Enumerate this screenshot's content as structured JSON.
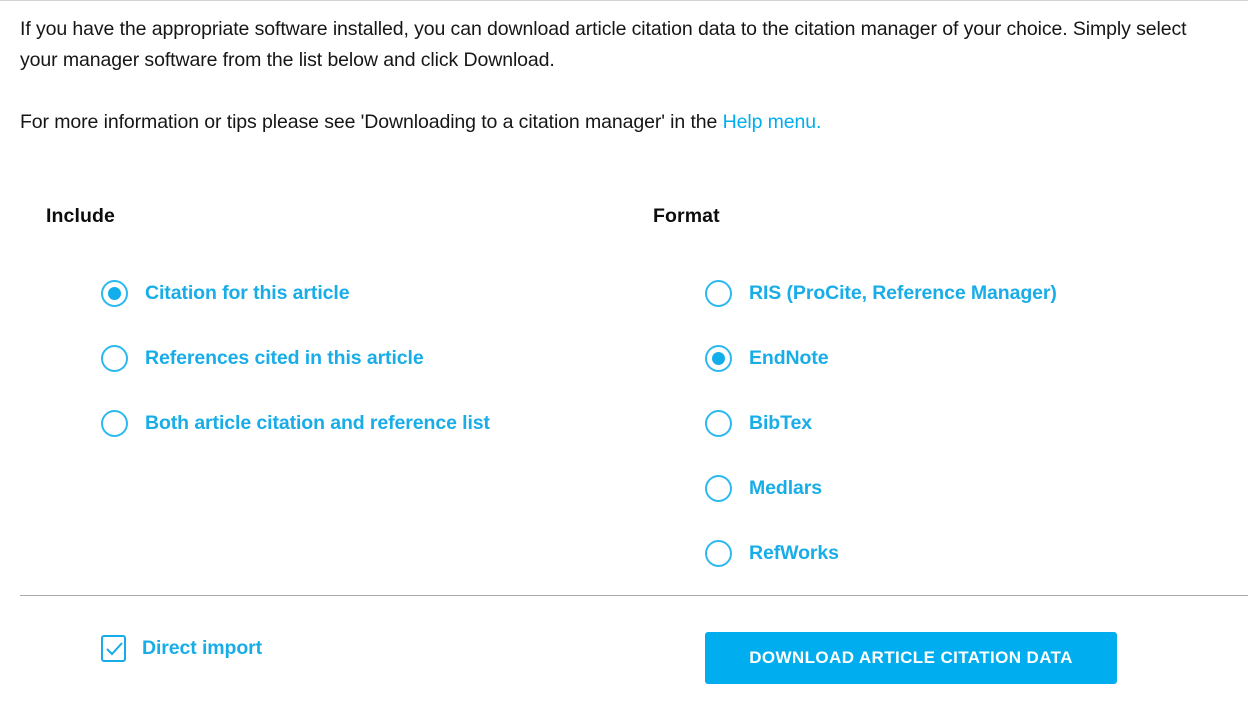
{
  "intro": {
    "paragraph1": "If you have the appropriate software installed, you can download article citation data to the citation manager of your choice. Simply select your manager software from the list below and click Download.",
    "paragraph2_before": "For more information or tips please see 'Downloading to a citation manager' in the ",
    "paragraph2_link": "Help menu.",
    "link_color": "#00ADEF"
  },
  "include": {
    "heading": "Include",
    "options": [
      {
        "label": "Citation for this article",
        "checked": true
      },
      {
        "label": "References cited in this article",
        "checked": false
      },
      {
        "label": "Both article citation and reference list",
        "checked": false
      }
    ]
  },
  "format": {
    "heading": "Format",
    "options": [
      {
        "label": "RIS (ProCite, Reference Manager)",
        "checked": false
      },
      {
        "label": "EndNote",
        "checked": true
      },
      {
        "label": "BibTex",
        "checked": false
      },
      {
        "label": "Medlars",
        "checked": false
      },
      {
        "label": "RefWorks",
        "checked": false
      }
    ]
  },
  "footer": {
    "direct_import_label": "Direct import",
    "direct_import_checked": true,
    "download_button_label": "DOWNLOAD ARTICLE CITATION DATA",
    "accent_color": "#00AEEF",
    "link_color": "#19ADE8"
  }
}
